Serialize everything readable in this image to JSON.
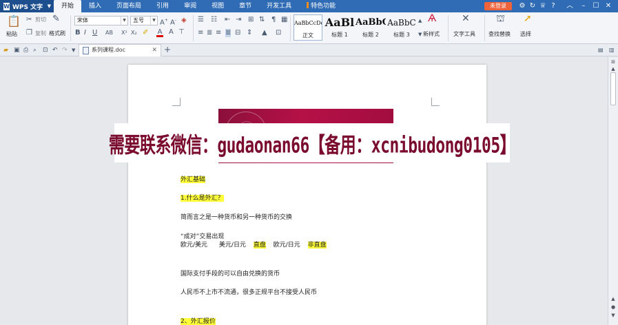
{
  "app": {
    "name": "WPS 文字",
    "menu_tabs": [
      "开始",
      "插入",
      "页面布局",
      "引用",
      "审阅",
      "视图",
      "章节",
      "开发工具",
      "特色功能"
    ],
    "active_tab": "开始",
    "login_label": "未登录",
    "help_label": "?"
  },
  "ribbon": {
    "paste_label": "粘贴",
    "cut_label": "剪切",
    "copy_label": "复制",
    "format_painter_label": "格式刷",
    "font_name": "宋体",
    "font_size": "五号",
    "styles": [
      {
        "sample": "AaBbCcDd",
        "name": "正文"
      },
      {
        "sample": "AaBl",
        "name": "标题 1"
      },
      {
        "sample": "AaBbC",
        "name": "标题 2"
      },
      {
        "sample": "AaBbC",
        "name": "标题 3"
      }
    ],
    "new_style_label": "新样式",
    "text_tools_label": "文字工具",
    "find_replace_label": "查找替换",
    "select_label": "选择"
  },
  "tabs": {
    "document_name": "系列课程.doc",
    "add_tab": "+"
  },
  "document": {
    "lines": [
      {
        "text": "外汇基础",
        "highlight": true
      },
      {
        "text": "1.什么是外汇？",
        "highlight": true
      },
      {
        "text": "简而言之是一种货币和另一种货币的交换",
        "highlight": false
      },
      {
        "text": "“成对”交易出现",
        "highlight": false
      },
      {
        "text": "国际支付手段的可以自由兑换的货币",
        "highlight": false
      },
      {
        "text": "人民币不上市不流通，很多正规平台不接受人民币",
        "highlight": false
      },
      {
        "text": "2、外汇报价",
        "highlight": true
      }
    ],
    "pairs_line": {
      "eur_usd": "欧元/美元",
      "usd_jpy": "美元/日元",
      "direct": "直盘",
      "eur_jpy": "欧元/日元",
      "cross": "非直盘"
    }
  },
  "watermark": {
    "text": "需要联系微信：gudaonan66【备用：xcnibudong0105】"
  },
  "colors": {
    "menubar": "#2f6cb5",
    "highlight": "#ffff3a",
    "banner": "#b51147",
    "watermark_text": "#7a0b2e",
    "login_button": "#f0623a"
  }
}
